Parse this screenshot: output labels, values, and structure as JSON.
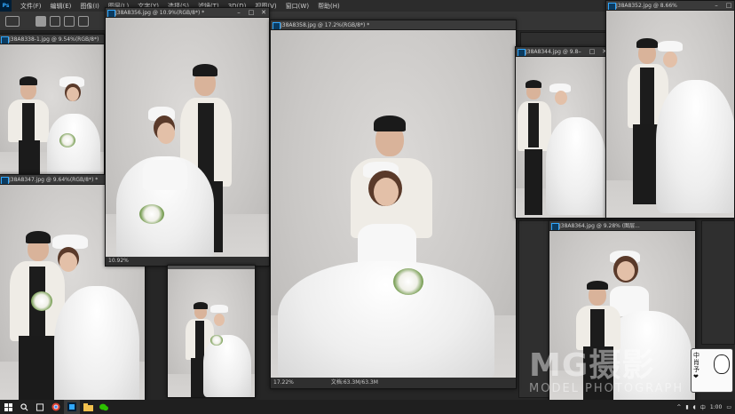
{
  "app": {
    "logo_text": "Ps"
  },
  "menu": {
    "items": [
      "文件(F)",
      "编辑(E)",
      "图像(I)",
      "图层(L)",
      "文字(Y)",
      "选择(S)",
      "滤镜(T)",
      "3D(D)",
      "视图(V)",
      "窗口(W)",
      "帮助(H)"
    ]
  },
  "windows": [
    {
      "title": "J38A8338-1.jpg @ 9.54%(RGB/8*)",
      "status": ""
    },
    {
      "title": "J38A8356.jpg @ 10.9%(RGB/8*) *",
      "status": "10.92%"
    },
    {
      "title": "J38A8358.jpg @ 17.2%(RGB/8*) *",
      "status": "17.22%",
      "doc": "文档:63.3M/63.3M"
    },
    {
      "title": "J38A8344.jpg @ 9.8",
      "status": ""
    },
    {
      "title": "J38A8352.jpg @ 8.66%",
      "status": ""
    },
    {
      "title": "J38A8347.jpg @ 9.64%(RGB/8*) *",
      "status": ""
    },
    {
      "title": "",
      "status": ""
    },
    {
      "title": "J38A8364.jpg @ 9.28% (图层...",
      "status": ""
    }
  ],
  "watermark": {
    "brand": "MG摄影",
    "sub": "MODEL PHOTOGRAPH"
  },
  "stamp": {
    "text": "中\n肖\n予\n❤"
  },
  "taskbar": {
    "clock": "1:00",
    "ime": "中"
  }
}
